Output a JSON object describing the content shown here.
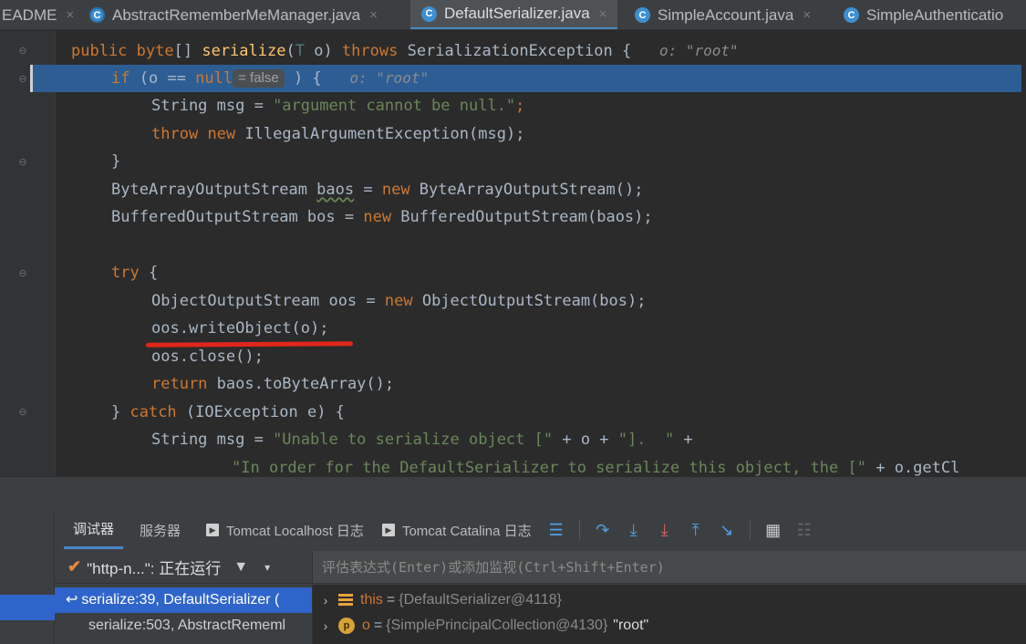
{
  "tabs": [
    {
      "label": "EADME",
      "active": false,
      "icon": "none"
    },
    {
      "label": "AbstractRememberMeManager.java",
      "active": false,
      "icon": "abstract-class-icon"
    },
    {
      "label": "DefaultSerializer.java",
      "active": true,
      "icon": "class-icon"
    },
    {
      "label": "SimpleAccount.java",
      "active": false,
      "icon": "class-icon"
    },
    {
      "label": "SimpleAuthenticatio",
      "active": false,
      "icon": "class-icon"
    }
  ],
  "tab_close_glyph": "×",
  "class_icon_letter": "C",
  "code": {
    "l1": {
      "kw1": "public",
      "type1": "byte",
      "brk": "[] ",
      "fn": "serialize",
      "p1": "(",
      "tparam": "T",
      "p2": " o) ",
      "kw2": "throws",
      "rest": " SerializationException {",
      "hint": "o: \"root\""
    },
    "l2": {
      "kw": "if",
      "pre": " (o == ",
      "kw2": "null",
      "inlay": "= false",
      "post": " ) {",
      "hint": "o: \"root\""
    },
    "l3": {
      "pre": "String msg = ",
      "str": "\"argument cannot be null.\"",
      "post": ";"
    },
    "l4": {
      "kw1": "throw",
      "kw2": "new",
      "rest": " IllegalArgumentException(msg);"
    },
    "l5": {
      "text": "}"
    },
    "l6": {
      "pre": "ByteArrayOutputStream ",
      "var": "baos",
      "mid": " = ",
      "kw": "new",
      "post": " ByteArrayOutputStream();"
    },
    "l7": {
      "pre": "BufferedOutputStream bos = ",
      "kw": "new",
      "post": " BufferedOutputStream(baos);"
    },
    "l8": {
      "kw": "try",
      "post": " {"
    },
    "l9": {
      "pre": "ObjectOutputStream oos = ",
      "kw": "new",
      "post": " ObjectOutputStream(bos);"
    },
    "l10": {
      "text": "oos.writeObject(o);"
    },
    "l11": {
      "text": "oos.close();"
    },
    "l12": {
      "kw": "return",
      "post": " baos.toByteArray();"
    },
    "l13": {
      "pre": "} ",
      "kw": "catch",
      "post": " (IOException e) {"
    },
    "l14": {
      "pre": "String msg = ",
      "str": "\"Unable to serialize object [\"",
      "post": " + o + ",
      "str2": "\"].  \"",
      "post2": " +"
    },
    "l15": {
      "str": "\"In order for the DefaultSerializer to serialize this object, the [\"",
      "post": " + o.getCl"
    }
  },
  "debug": {
    "tabs": [
      {
        "label": "调试器",
        "active": true
      },
      {
        "label": "服务器",
        "active": false
      },
      {
        "label": "Tomcat Localhost 日志",
        "active": false
      },
      {
        "label": "Tomcat Catalina 日志",
        "active": false
      }
    ],
    "thread": {
      "name": "\"http-n...\": 正在运行",
      "check": "✔",
      "filter": "▼",
      "dropdown": "▾"
    },
    "eval_placeholder": "评估表达式(Enter)或添加监视(Ctrl+Shift+Enter)",
    "frames": [
      {
        "label": "serialize:39, DefaultSerializer (",
        "arrow": "↩"
      },
      {
        "label": "serialize:503, AbstractRememl"
      }
    ],
    "variables": [
      {
        "name": "this",
        "eq": "=",
        "value": "{DefaultSerializer@4118}",
        "text": "",
        "icon": "stack-icon"
      },
      {
        "name": "o",
        "eq": "=",
        "value": "{SimplePrincipalCollection@4130}",
        "text": "\"root\"",
        "icon": "p-icon",
        "icon_letter": "p"
      }
    ],
    "chevron": "›"
  },
  "colors": {
    "editor_bg": "#2b2b2b",
    "execution_line": "#2d5e93",
    "keyword": "#cc7832",
    "function": "#ffc66d",
    "string": "#6a8759",
    "red_annotation": "#e0261c",
    "selection": "#2f65ca"
  }
}
